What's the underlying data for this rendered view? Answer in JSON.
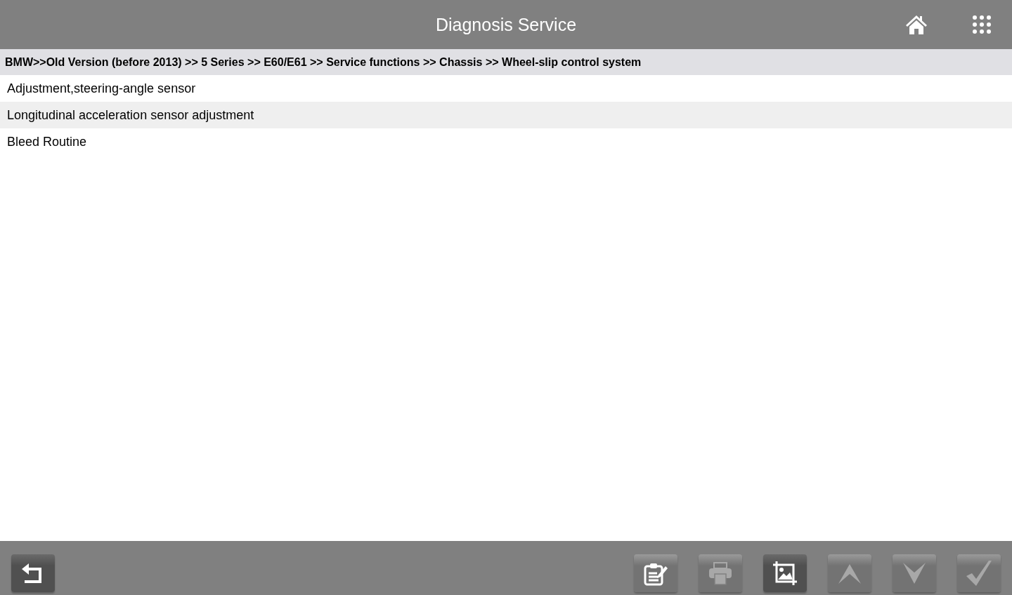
{
  "header": {
    "title": "Diagnosis Service"
  },
  "breadcrumb": "BMW>>Old Version (before 2013) >> 5 Series >> E60/E61 >> Service functions >> Chassis >> Wheel-slip control system",
  "items": [
    "Adjustment,steering-angle sensor",
    "Longitudinal acceleration sensor adjustment",
    "Bleed Routine"
  ],
  "toolbar": [
    {
      "kind": "back",
      "disabled": false
    },
    {
      "kind": "report",
      "disabled": false
    },
    {
      "kind": "print",
      "disabled": true
    },
    {
      "kind": "screenshot",
      "disabled": false
    },
    {
      "kind": "up",
      "disabled": true
    },
    {
      "kind": "down",
      "disabled": true
    },
    {
      "kind": "confirm",
      "disabled": true
    }
  ]
}
